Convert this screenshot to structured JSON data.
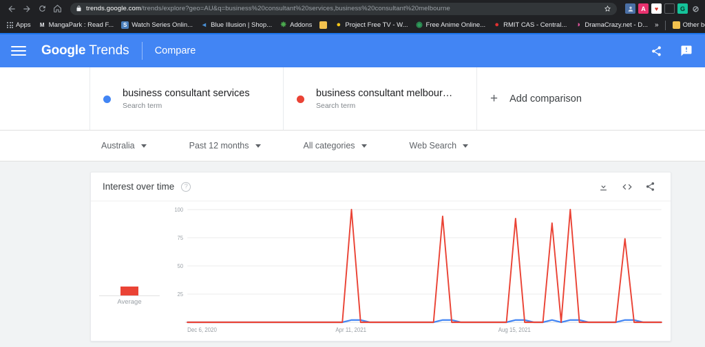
{
  "browser": {
    "nav": {
      "back": "back-arrow",
      "forward": "forward-arrow",
      "reload": "reload-icon",
      "home": "home-icon"
    },
    "omnibox": {
      "lock": "lock-icon",
      "host": "trends.google.com",
      "path": "/trends/explore?geo=AU&q=business%20consultant%20services,business%20consultant%20melbourne",
      "full_url": "trends.google.com/trends/explore?geo=AU&q=business%20consultant%20services,business%20consultant%20melbourne",
      "star": "star-icon"
    },
    "extensions": [
      {
        "name": "profile-avatar-icon",
        "glyph": "●",
        "bg": "#4a6fa5",
        "fg": "#ffffff"
      },
      {
        "name": "adblock-extension-icon",
        "glyph": "A",
        "bg": "#e8316e",
        "fg": "#ffffff"
      },
      {
        "name": "privacy-extension-icon",
        "glyph": "♥",
        "bg": "#ffffff",
        "fg": "#d93025"
      },
      {
        "name": "flag-extension-icon",
        "glyph": "⬚",
        "bg": "#202124",
        "fg": "#5f6368"
      },
      {
        "name": "grammarly-extension-icon",
        "glyph": "G",
        "bg": "#15c39a",
        "fg": "#0b3d30"
      },
      {
        "name": "block-extension-icon",
        "glyph": "⊘",
        "bg": "#202124",
        "fg": "#9aa0a6"
      }
    ],
    "bookmarks": {
      "apps_label": "Apps",
      "items": [
        {
          "label": "MangaPark : Read F...",
          "glyph": "M",
          "bg": "#202124",
          "fg": "#e8eaed"
        },
        {
          "label": "Watch Series Onlin...",
          "glyph": "S",
          "bg": "#4a7ebb",
          "fg": "#ffffff"
        },
        {
          "label": "Blue Illusion | Shop...",
          "glyph": "◢",
          "bg": "#202124",
          "fg": "#4a8fd4"
        },
        {
          "label": "Addons",
          "glyph": "✳",
          "bg": "#202124",
          "fg": "#4caf50"
        },
        {
          "label": "",
          "glyph": "▮",
          "bg": "#f2c14e",
          "fg": "#f2c14e"
        },
        {
          "label": "Project Free TV - W...",
          "glyph": "●",
          "bg": "#202124",
          "fg": "#f5c518"
        },
        {
          "label": "Free Anime Online...",
          "glyph": "◉",
          "bg": "#202124",
          "fg": "#2e9e5b"
        },
        {
          "label": "RMIT CAS - Central...",
          "glyph": "●",
          "bg": "#202124",
          "fg": "#e03131"
        },
        {
          "label": "DramaCrazy.net - D...",
          "glyph": "◑",
          "bg": "#202124",
          "fg": "#e0559c"
        }
      ],
      "overflow_label": "»",
      "other_bookmarks_label": "Other bookmarks",
      "other_bookmarks_glyph": "▮"
    }
  },
  "app": {
    "menu_icon": "hamburger-menu-icon",
    "brand_google": "Google",
    "brand_trends": "Trends",
    "section_title": "Compare",
    "share_icon": "share-icon",
    "feedback_icon": "feedback-icon",
    "accent_color": "#4285f4"
  },
  "compare": {
    "terms": [
      {
        "term": "business consultant services",
        "type_label": "Search term",
        "color": "#4285f4"
      },
      {
        "term": "business consultant melbour…",
        "type_label": "Search term",
        "color": "#ea4335"
      }
    ],
    "add_plus": "+",
    "add_label": "Add comparison"
  },
  "filters": [
    {
      "name": "region",
      "label": "Australia"
    },
    {
      "name": "time-range",
      "label": "Past 12 months"
    },
    {
      "name": "category",
      "label": "All categories"
    },
    {
      "name": "search-type",
      "label": "Web Search"
    }
  ],
  "interest_card": {
    "title": "Interest over time",
    "help_icon": "help-circle-icon",
    "download_icon": "download-icon",
    "embed_icon": "embed-code-icon",
    "share_icon": "share-icon",
    "average_label": "Average",
    "average_value": 13
  },
  "chart_data": {
    "type": "line",
    "title": "Interest over time",
    "xlabel": "",
    "ylabel": "",
    "ylim": [
      0,
      100
    ],
    "yticks": [
      100,
      75,
      50,
      25
    ],
    "xticks": [
      {
        "label": "Dec 6, 2020",
        "pos": 0.0
      },
      {
        "label": "Apr 11, 2021",
        "pos": 0.345
      },
      {
        "label": "Aug 15, 2021",
        "pos": 0.69
      }
    ],
    "grid": true,
    "legend": "none",
    "x_count": 53,
    "series": [
      {
        "name": "business consultant services",
        "color": "#4285f4",
        "values": [
          0,
          0,
          0,
          0,
          0,
          0,
          0,
          0,
          0,
          0,
          0,
          0,
          0,
          0,
          0,
          0,
          0,
          0,
          2,
          2,
          0,
          0,
          0,
          0,
          0,
          0,
          0,
          0,
          2,
          2,
          0,
          0,
          0,
          0,
          0,
          0,
          2,
          2,
          0,
          0,
          2,
          0,
          2,
          2,
          0,
          0,
          0,
          0,
          2,
          2,
          0,
          0,
          0
        ]
      },
      {
        "name": "business consultant melbourne",
        "color": "#ea4335",
        "values": [
          0,
          0,
          0,
          0,
          0,
          0,
          0,
          0,
          0,
          0,
          0,
          0,
          0,
          0,
          0,
          0,
          0,
          0,
          100,
          0,
          0,
          0,
          0,
          0,
          0,
          0,
          0,
          0,
          94,
          0,
          0,
          0,
          0,
          0,
          0,
          0,
          92,
          0,
          0,
          0,
          88,
          0,
          100,
          0,
          0,
          0,
          0,
          0,
          74,
          0,
          0,
          0,
          0
        ]
      }
    ],
    "peaks": [
      {
        "index": 18,
        "value": 100
      },
      {
        "index": 28,
        "value": 94
      },
      {
        "index": 36,
        "value": 92
      },
      {
        "index": 40,
        "value": 88
      },
      {
        "index": 42,
        "value": 100
      },
      {
        "index": 48,
        "value": 74
      }
    ]
  }
}
